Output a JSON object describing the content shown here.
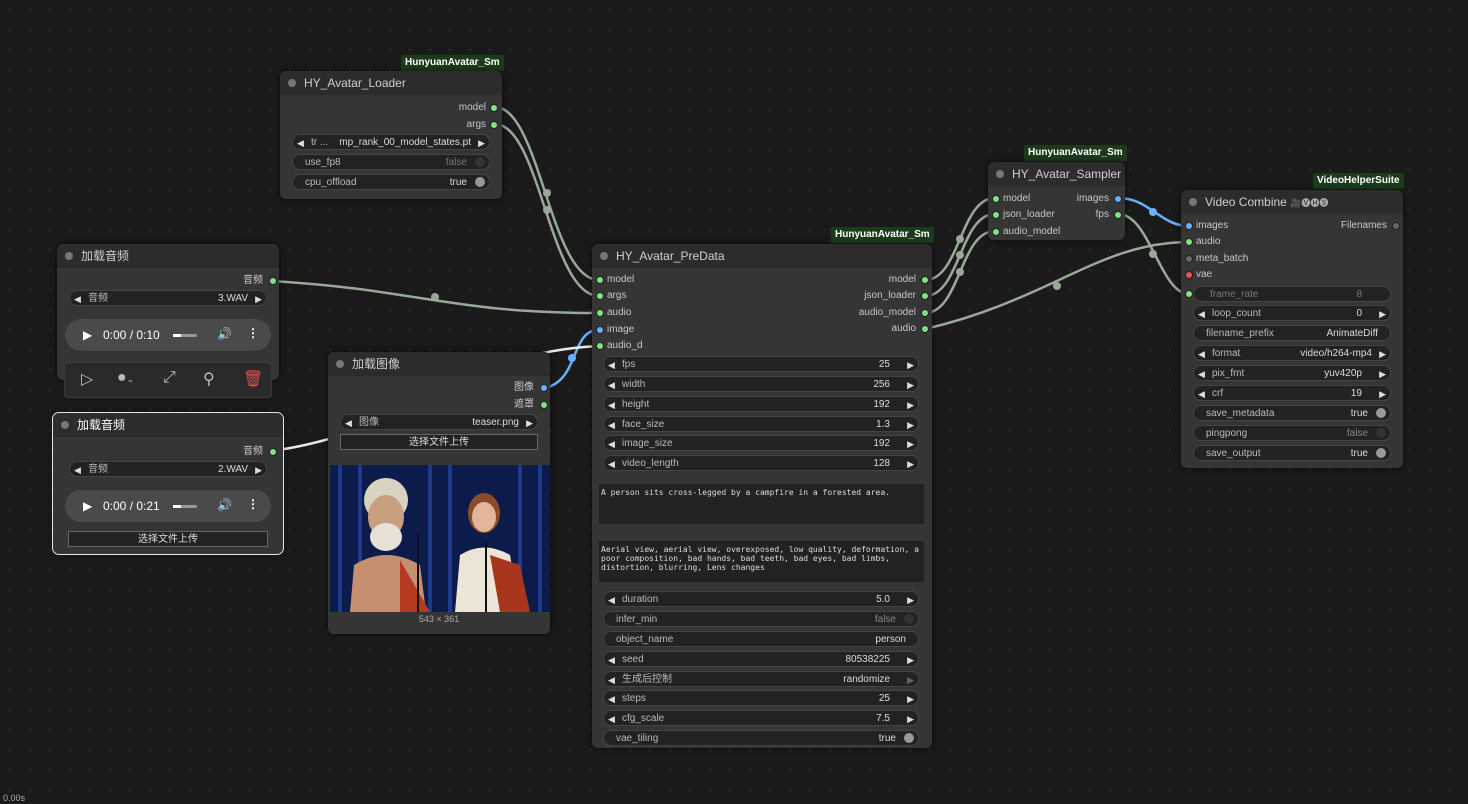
{
  "footer": {
    "time": "0.00s"
  },
  "loader": {
    "badge": "HunyuanAvatar_Sm",
    "title": "HY_Avatar_Loader",
    "outputs": [
      "model",
      "args"
    ],
    "tr_label": "tr ...",
    "tr_value": "mp_rank_00_model_states.pt",
    "use_fp8_label": "use_fp8",
    "use_fp8_value": "false",
    "cpu_offload_label": "cpu_offload",
    "cpu_offload_value": "true"
  },
  "audio1": {
    "title": "加载音频",
    "output": "音频",
    "combo_label": "音频",
    "combo_value": "3.WAV",
    "player_time": "0:00 / 0:10"
  },
  "audio2": {
    "title": "加载音频",
    "output": "音频",
    "combo_label": "音频",
    "combo_value": "2.WAV",
    "player_time": "0:00 / 0:21",
    "upload": "选择文件上传"
  },
  "image": {
    "title": "加载图像",
    "outputs": [
      "图像",
      "遮罩"
    ],
    "combo_label": "图像",
    "combo_value": "teaser.png",
    "upload": "选择文件上传",
    "size": "543 × 361"
  },
  "predata": {
    "badge": "HunyuanAvatar_Sm",
    "title": "HY_Avatar_PreData",
    "inputs": [
      "model",
      "args",
      "audio",
      "image",
      "audio_d"
    ],
    "outputs": [
      "model",
      "json_loader",
      "audio_model",
      "audio"
    ],
    "widgets1": [
      {
        "label": "fps",
        "value": "25"
      },
      {
        "label": "width",
        "value": "256"
      },
      {
        "label": "height",
        "value": "192"
      },
      {
        "label": "face_size",
        "value": "1.3"
      },
      {
        "label": "image_size",
        "value": "192"
      },
      {
        "label": "video_length",
        "value": "128"
      }
    ],
    "prompt": "A person sits cross-legged by a campfire in a forested area.",
    "negative": "Aerial view, aerial view, overexposed, low quality, deformation, a poor composition, bad hands, bad teeth, bad eyes, bad limbs, distortion, blurring, Lens changes",
    "duration_label": "duration",
    "duration_value": "5.0",
    "infer_min_label": "infer_min",
    "infer_min_value": "false",
    "object_name_label": "object_name",
    "object_name_value": "person",
    "seed_label": "seed",
    "seed_value": "80538225",
    "control_label": "生成后控制",
    "control_value": "randomize",
    "steps_label": "steps",
    "steps_value": "25",
    "cfg_label": "cfg_scale",
    "cfg_value": "7.5",
    "vae_tiling_label": "vae_tiling",
    "vae_tiling_value": "true"
  },
  "sampler": {
    "badge": "HunyuanAvatar_Sm",
    "title": "HY_Avatar_Sampler",
    "inputs": [
      "model",
      "json_loader",
      "audio_model"
    ],
    "outputs": [
      "images",
      "fps"
    ]
  },
  "combine": {
    "badge": "VideoHelperSuite",
    "title": "Video Combine",
    "title_icons": "🎥🅥🅗🅢",
    "inputs": [
      "images",
      "audio",
      "meta_batch",
      "vae"
    ],
    "output": "Filenames",
    "frame_rate_label": "frame_rate",
    "frame_rate_value": "8",
    "loop_count_label": "loop_count",
    "loop_count_value": "0",
    "filename_prefix_label": "filename_prefix",
    "filename_prefix_value": "AnimateDiff",
    "format_label": "format",
    "format_value": "video/h264-mp4",
    "pix_fmt_label": "pix_fmt",
    "pix_fmt_value": "yuv420p",
    "crf_label": "crf",
    "crf_value": "19",
    "save_metadata_label": "save_metadata",
    "save_metadata_value": "true",
    "pingpong_label": "pingpong",
    "pingpong_value": "false",
    "save_output_label": "save_output",
    "save_output_value": "true"
  },
  "colors": {
    "link": "#9aa89a",
    "image_link": "#6ab0ff",
    "accent": "#1b3b1b"
  }
}
